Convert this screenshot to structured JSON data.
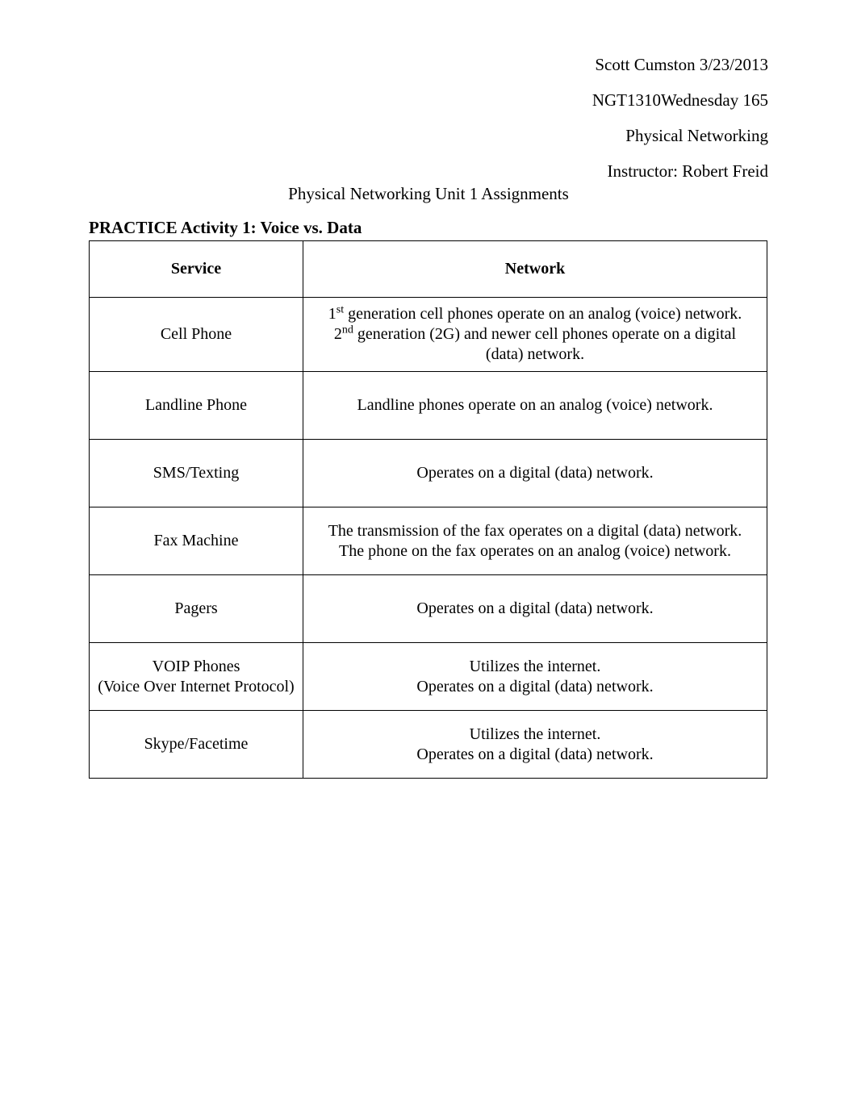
{
  "header": {
    "line1": "Scott Cumston 3/23/2013",
    "line2": "NGT1310Wednesday 165",
    "line3": "Physical Networking",
    "line4": "Instructor: Robert Freid"
  },
  "page_title": "Physical Networking Unit 1 Assignments",
  "section_title": "PRACTICE Activity 1: Voice vs. Data",
  "table": {
    "headers": {
      "service": "Service",
      "network": "Network"
    },
    "rows": [
      {
        "service_html": "Cell Phone",
        "network_html": "1<sup>st</sup> generation cell phones operate on an analog (voice) network.\n2<sup>nd</sup> generation (2G) and newer cell phones operate on a digital\n(data) network."
      },
      {
        "service_html": "Landline Phone",
        "network_html": "Landline phones operate on an analog (voice) network."
      },
      {
        "service_html": "SMS/Texting",
        "network_html": "Operates on a digital (data) network."
      },
      {
        "service_html": "Fax Machine",
        "network_html": "The transmission of the fax operates on a digital (data) network.\nThe phone on the fax operates on an analog (voice) network."
      },
      {
        "service_html": "Pagers",
        "network_html": "Operates on a digital (data) network."
      },
      {
        "service_html": "VOIP Phones\n(Voice Over Internet Protocol)",
        "network_html": "Utilizes the internet.\nOperates on a digital (data) network."
      },
      {
        "service_html": "Skype/Facetime",
        "network_html": "Utilizes the internet.\nOperates on a digital (data) network."
      }
    ]
  }
}
